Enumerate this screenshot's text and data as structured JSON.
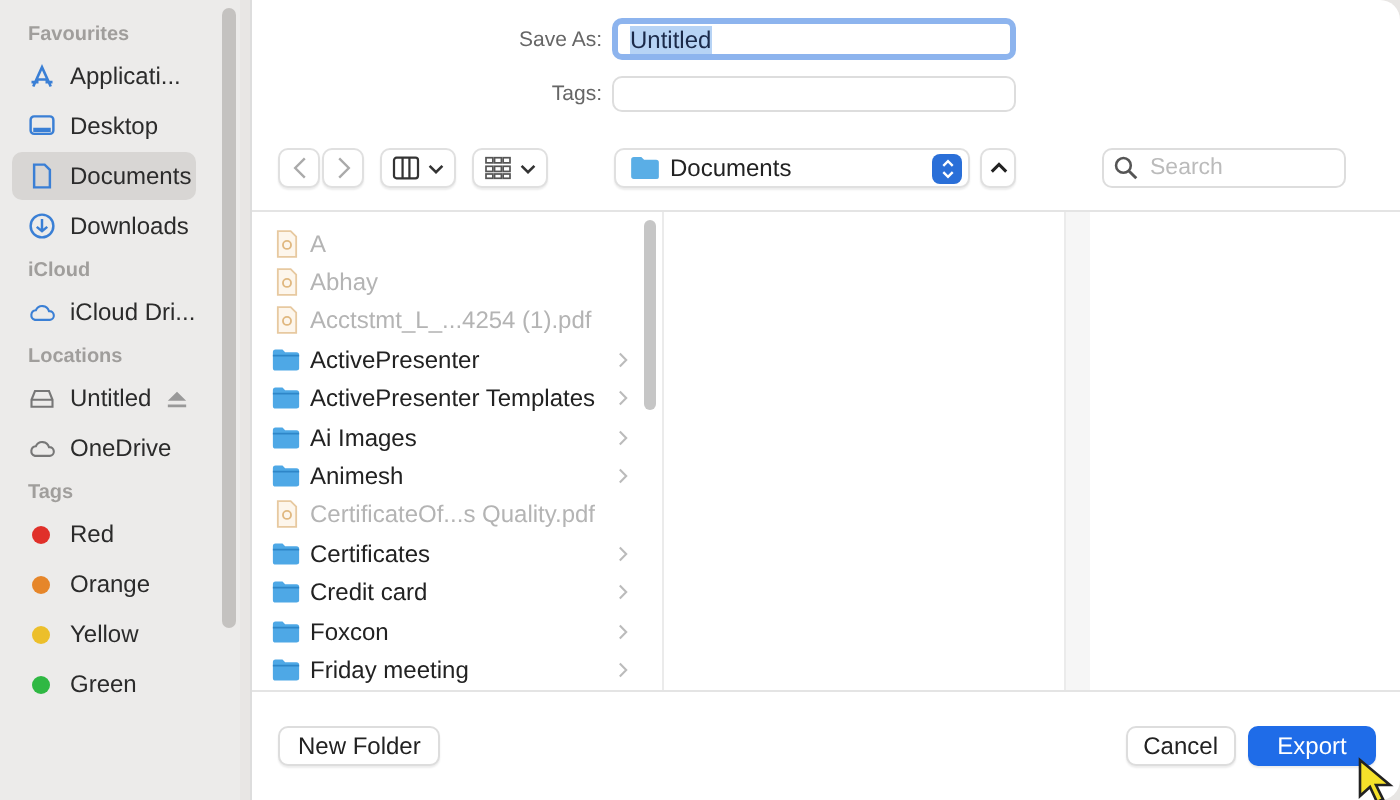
{
  "sidebar": {
    "sections": [
      {
        "title": "Favourites",
        "items": [
          {
            "label": "Applicati...",
            "kind": "apps",
            "selected": false
          },
          {
            "label": "Desktop",
            "kind": "desktop",
            "selected": false
          },
          {
            "label": "Documents",
            "kind": "doc",
            "selected": true
          },
          {
            "label": "Downloads",
            "kind": "download",
            "selected": false
          }
        ]
      },
      {
        "title": "iCloud",
        "items": [
          {
            "label": "iCloud Dri...",
            "kind": "cloud",
            "selected": false
          }
        ]
      },
      {
        "title": "Locations",
        "items": [
          {
            "label": "Untitled",
            "kind": "drive",
            "selected": false,
            "eject": true
          },
          {
            "label": "OneDrive",
            "kind": "cloud",
            "selected": false
          }
        ]
      },
      {
        "title": "Tags",
        "items": [
          {
            "label": "Red",
            "color": "#e0302a",
            "selected": false
          },
          {
            "label": "Orange",
            "color": "#e6862a",
            "selected": false
          },
          {
            "label": "Yellow",
            "color": "#ecbf2b",
            "selected": false
          },
          {
            "label": "Green",
            "color": "#2fb843",
            "selected": false
          }
        ]
      }
    ]
  },
  "save_as": {
    "label": "Save As:",
    "value": "Untitled"
  },
  "tags": {
    "label": "Tags:"
  },
  "location": {
    "label": "Documents"
  },
  "search": {
    "placeholder": "Search"
  },
  "files": [
    {
      "name": "A",
      "kind": "file",
      "disabled": true
    },
    {
      "name": "Abhay",
      "kind": "file",
      "disabled": true
    },
    {
      "name": "Acctstmt_L_...4254 (1).pdf",
      "kind": "file",
      "disabled": true
    },
    {
      "name": "ActivePresenter",
      "kind": "folder",
      "disabled": false
    },
    {
      "name": "ActivePresenter Templates",
      "kind": "folder",
      "disabled": false
    },
    {
      "name": "Ai Images",
      "kind": "folder",
      "disabled": false
    },
    {
      "name": "Animesh",
      "kind": "folder",
      "disabled": false
    },
    {
      "name": "CertificateOf...s Quality.pdf",
      "kind": "file",
      "disabled": true
    },
    {
      "name": "Certificates",
      "kind": "folder",
      "disabled": false
    },
    {
      "name": "Credit card",
      "kind": "folder",
      "disabled": false
    },
    {
      "name": "Foxcon",
      "kind": "folder",
      "disabled": false
    },
    {
      "name": "Friday meeting",
      "kind": "folder",
      "disabled": false
    }
  ],
  "buttons": {
    "new_folder": "New Folder",
    "cancel": "Cancel",
    "export": "Export"
  }
}
